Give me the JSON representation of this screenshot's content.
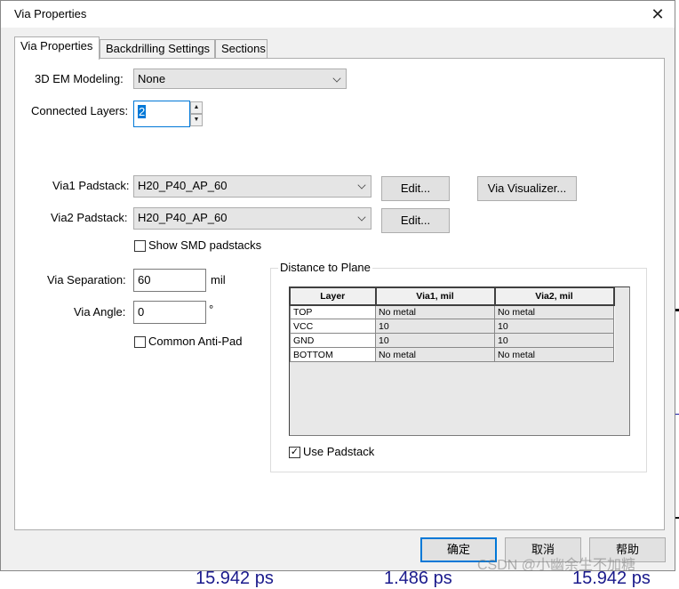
{
  "dialog": {
    "title": "Via Properties"
  },
  "tabs": [
    "Via Properties",
    "Backdrilling Settings",
    "Sections"
  ],
  "em_modeling": {
    "label": "3D EM Modeling:",
    "value": "None"
  },
  "connected_layers": {
    "label": "Connected Layers:",
    "value": "2"
  },
  "via1_padstack": {
    "label": "Via1 Padstack:",
    "value": "H20_P40_AP_60",
    "edit_label": "Edit..."
  },
  "via2_padstack": {
    "label": "Via2 Padstack:",
    "value": "H20_P40_AP_60",
    "edit_label": "Edit..."
  },
  "via_visualizer_label": "Via Visualizer...",
  "show_smd": {
    "label": "Show SMD padstacks",
    "checked": false
  },
  "via_separation": {
    "label": "Via Separation:",
    "value": "60",
    "unit": "mil"
  },
  "via_angle": {
    "label": "Via Angle:",
    "value": "0",
    "unit": "°"
  },
  "common_antipad": {
    "label": "Common Anti-Pad",
    "checked": false
  },
  "distance_to_plane": {
    "title": "Distance to Plane",
    "columns": [
      "Layer",
      "Via1, mil",
      "Via2, mil"
    ],
    "rows": [
      [
        "TOP",
        "No metal",
        "No metal"
      ],
      [
        "VCC",
        "10",
        "10"
      ],
      [
        "GND",
        "10",
        "10"
      ],
      [
        "BOTTOM",
        "No metal",
        "No metal"
      ]
    ],
    "use_padstack": {
      "label": "Use Padstack",
      "checked": true
    }
  },
  "footer": {
    "ok": "确定",
    "cancel": "取消",
    "help": "帮助"
  },
  "background_numbers": [
    "15.942 ps",
    "1.486 ps",
    "15.942 ps"
  ],
  "watermark": "CSDN @小幽余生不加糖",
  "colors": {
    "accent": "#0078d7",
    "background_trace": "#1a1aa0"
  }
}
